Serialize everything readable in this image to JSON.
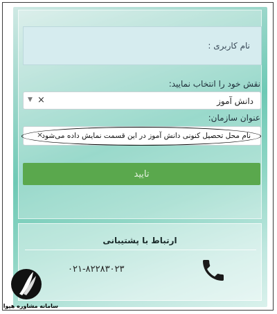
{
  "form": {
    "username_placeholder": "نام کاربری :",
    "role_label": "نقش خود را انتخاب نمایید:",
    "role_value": "دانش آموز",
    "clear_symbol": "×",
    "caret_symbol": "▼",
    "org_label": "عنوان سازمان:",
    "org_value": "نام محل تحصیل کنونی دانش آموز در این قسمت نمایش داده می‌شود",
    "org_clear_symbol": "×",
    "submit_label": "تایید"
  },
  "support": {
    "title": "ارتباط با پشتیبانی",
    "phone": "۰۲۱-۸۲۲۸۳۰۲۳",
    "icon": "phone-icon"
  },
  "watermark": {
    "text": "سامانه مشاوره هپوا"
  },
  "colors": {
    "confirm_button": "#5aa84d",
    "background_accent": "#6ec9b5"
  }
}
